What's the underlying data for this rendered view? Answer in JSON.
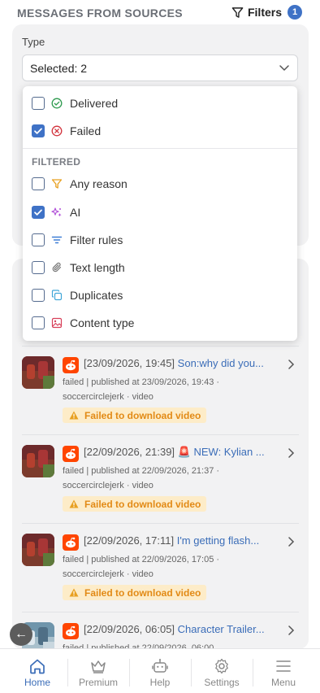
{
  "header": {
    "title": "MESSAGES FROM SOURCES",
    "filters_label": "Filters",
    "filters_count": "1"
  },
  "filter": {
    "type_label": "Type",
    "select_value": "Selected: 2",
    "options": [
      {
        "label": "Delivered",
        "checked": false,
        "icon": "check-circle-icon"
      },
      {
        "label": "Failed",
        "checked": true,
        "icon": "x-circle-icon"
      }
    ],
    "filtered_heading": "FILTERED",
    "filtered_options": [
      {
        "label": "Any reason",
        "checked": false,
        "icon": "funnel-icon"
      },
      {
        "label": "AI",
        "checked": true,
        "icon": "sparkles-icon"
      },
      {
        "label": "Filter rules",
        "checked": false,
        "icon": "filter-lines-icon"
      },
      {
        "label": "Text length",
        "checked": false,
        "icon": "paperclip-icon"
      },
      {
        "label": "Duplicates",
        "checked": false,
        "icon": "copy-icon"
      },
      {
        "label": "Content type",
        "checked": false,
        "icon": "image-icon"
      }
    ]
  },
  "messages": [
    {
      "timestamp": "[23/09/2026, 19:45]",
      "title": "Son:why did you...",
      "status_line": "failed | published at 23/09/2026, 19:43 ·",
      "source_line": "soccercirclejerk · video",
      "warning": "Failed to download video"
    },
    {
      "timestamp": "[22/09/2026, 21:39]",
      "title": "🚨 NEW: Kylian ...",
      "status_line": "failed | published at 22/09/2026, 21:37 ·",
      "source_line": "soccercirclejerk · video",
      "warning": "Failed to download video"
    },
    {
      "timestamp": "[22/09/2026, 17:11]",
      "title": "I'm getting flash...",
      "status_line": "failed | published at 22/09/2026, 17:05 ·",
      "source_line": "soccercirclejerk · video",
      "warning": "Failed to download video"
    },
    {
      "timestamp": "[22/09/2026, 06:05]",
      "title": "Character Trailer...",
      "status_line": "failed | published at 22/09/2026, 06:00",
      "source_line": "",
      "warning": ""
    }
  ],
  "nav": {
    "home": "Home",
    "premium": "Premium",
    "help": "Help",
    "settings": "Settings",
    "menu": "Menu"
  },
  "colors": {
    "accent": "#3f72c6",
    "link": "#3b6db8",
    "warning_bg": "#fdecc8",
    "warning_text": "#e28a16",
    "source_brand": "#ff4500"
  }
}
